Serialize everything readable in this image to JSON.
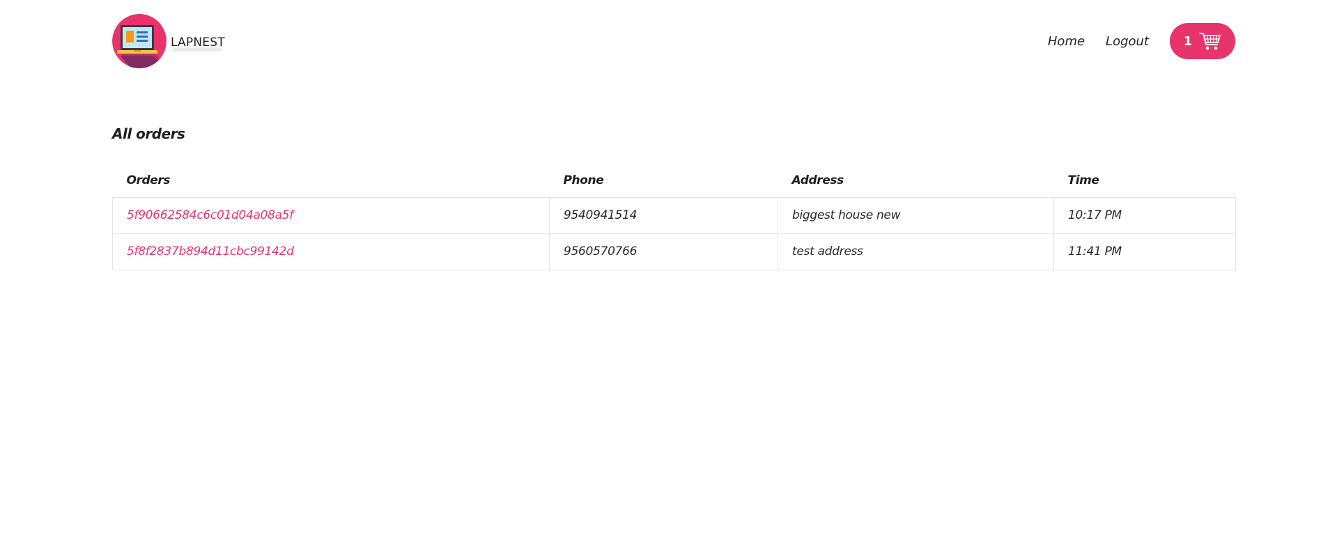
{
  "header": {
    "brand": "LAPNEST",
    "nav": {
      "home_label": "Home",
      "logout_label": "Logout"
    },
    "cart": {
      "count": "1",
      "icon": "cart-icon"
    }
  },
  "main": {
    "title": "All orders",
    "table": {
      "columns": [
        "Orders",
        "Phone",
        "Address",
        "Time"
      ],
      "rows": [
        {
          "order": "5f90662584c6c01d04a08a5f",
          "phone": "9540941514",
          "address": "biggest house new",
          "time": "10:17 PM"
        },
        {
          "order": "5f8f2837b894d11cbc99142d",
          "phone": "9560570766",
          "address": "test address",
          "time": "11:41 PM"
        }
      ]
    }
  },
  "colors": {
    "accent": "#e8336b",
    "text": "#1e1e24",
    "border": "#e4e4e7",
    "logo_bg": "#e8336b",
    "logo_shadow": "#7b2a5e"
  }
}
